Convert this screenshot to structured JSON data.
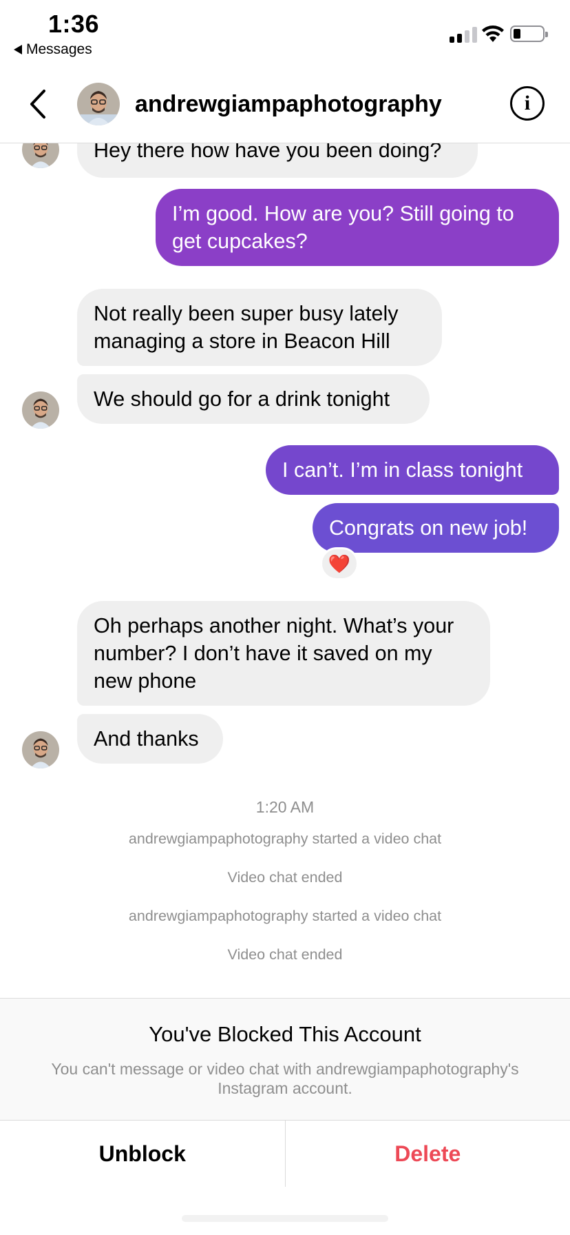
{
  "status_bar": {
    "time": "1:36",
    "back_app_label": "Messages",
    "icons": [
      "cellular-signal-icon",
      "wifi-icon",
      "battery-icon"
    ]
  },
  "header": {
    "username": "andrewgiampaphotography",
    "back_icon": "chevron-left-icon",
    "info_icon": "info-icon",
    "info_glyph": "i"
  },
  "messages": {
    "m0": "Hey there how have you been doing?",
    "m1": "I’m good. How are you? Still going to get cupcakes?",
    "m2": "Not really been super busy lately managing a store in Beacon Hill",
    "m3": "We should go for a drink tonight",
    "m4": "I can’t. I’m in class tonight",
    "m5": "Congrats on new job!",
    "m5_reaction": "❤️",
    "m6": "Oh perhaps another night. What’s your number? I don’t have it saved on my new phone",
    "m7": "And thanks"
  },
  "timeline": {
    "timestamp": "1:20 AM",
    "events": [
      "andrewgiampaphotography started a video chat",
      "Video chat ended",
      "andrewgiampaphotography started a video chat",
      "Video chat ended"
    ]
  },
  "blocked_panel": {
    "title": "You've Blocked This Account",
    "description": "You can't message or video chat with andrewgiampaphotography's Instagram account."
  },
  "actions": {
    "unblock_label": "Unblock",
    "delete_label": "Delete"
  },
  "colors": {
    "outgoing_top": "#8c3ec6",
    "outgoing_bottom": "#6a4fd2",
    "incoming_bubble": "#efefef",
    "delete_red": "#ed4956",
    "secondary_text": "#8e8e8e"
  }
}
